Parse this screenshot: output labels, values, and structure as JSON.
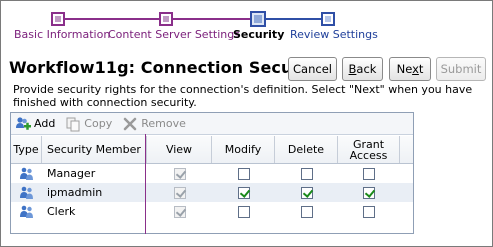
{
  "train": {
    "steps": [
      {
        "label": "Basic Information",
        "state": "visited"
      },
      {
        "label": "Content Server Settings",
        "state": "visited"
      },
      {
        "label": "Security",
        "state": "current"
      },
      {
        "label": "Review Settings",
        "state": "future"
      }
    ]
  },
  "header": {
    "title": "Workflow11g: Connection Security",
    "buttons": {
      "cancel": "Cancel",
      "back_prefix": "",
      "back_accel": "B",
      "back_rest": "ack",
      "next_prefix": "Ne",
      "next_accel": "x",
      "next_rest": "t",
      "submit": "Submit"
    }
  },
  "description": "Provide security rights for the connection's definition. Select \"Next\" when you have finished with connection security.",
  "toolbar": {
    "add": "Add",
    "copy": "Copy",
    "remove": "Remove"
  },
  "table": {
    "columns": {
      "type": "Type",
      "member": "Security Member",
      "view": "View",
      "modify": "Modify",
      "delete": "Delete",
      "grant": "Grant Access"
    },
    "rows": [
      {
        "member": "Manager",
        "view": true,
        "modify": false,
        "delete": false,
        "grant": false,
        "selected": false
      },
      {
        "member": "ipmadmin",
        "view": true,
        "modify": true,
        "delete": true,
        "grant": true,
        "selected": true
      },
      {
        "member": "Clerk",
        "view": true,
        "modify": false,
        "delete": false,
        "grant": false,
        "selected": false
      }
    ]
  },
  "colors": {
    "visited": "#8a2f8a",
    "future": "#2f4fa6",
    "check": "#1a8a1a"
  }
}
